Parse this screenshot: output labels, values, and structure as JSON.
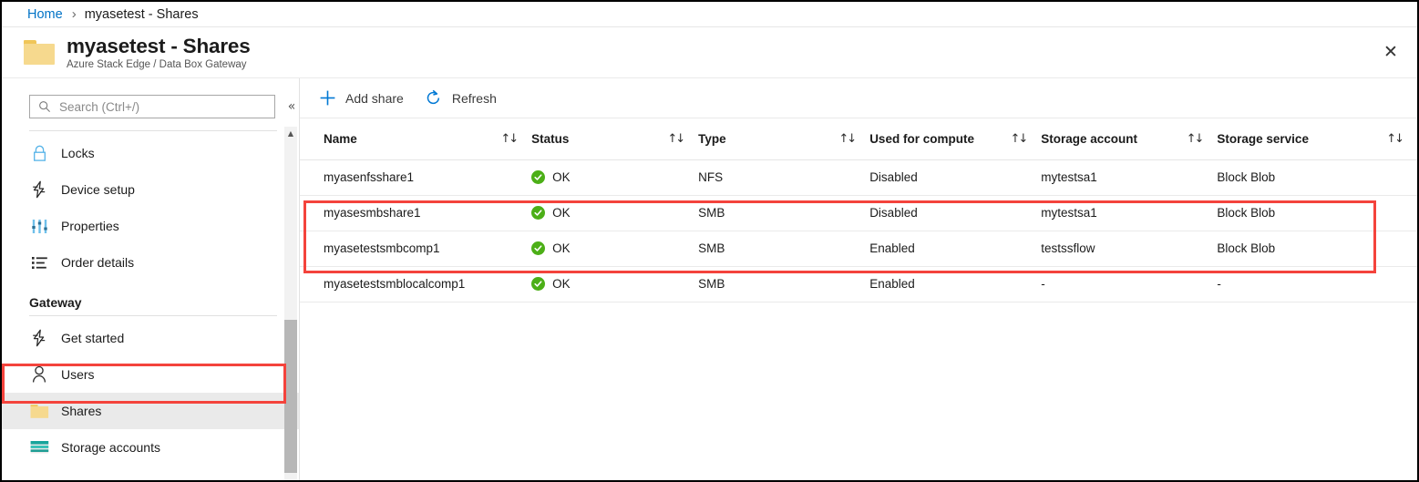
{
  "breadcrumb": {
    "home": "Home",
    "separator": "›",
    "current": "myasetest - Shares"
  },
  "header": {
    "icon": "folder-icon",
    "title": "myasetest - Shares",
    "subtitle": "Azure Stack Edge / Data Box Gateway",
    "close_label": "✕"
  },
  "sidebar": {
    "search": {
      "placeholder": "Search (Ctrl+/)",
      "value": "",
      "icon": "search-icon"
    },
    "collapse_label": "«",
    "scroll_up_label": "▲",
    "items": [
      {
        "label": "Locks",
        "icon": "lock-icon",
        "selected": false
      },
      {
        "label": "Device setup",
        "icon": "lightning-icon",
        "selected": false
      },
      {
        "label": "Properties",
        "icon": "sliders-icon",
        "selected": false
      },
      {
        "label": "Order details",
        "icon": "list-icon",
        "selected": false
      }
    ],
    "group": {
      "title": "Gateway",
      "items": [
        {
          "label": "Get started",
          "icon": "lightning-icon",
          "selected": false
        },
        {
          "label": "Users",
          "icon": "person-icon",
          "selected": false
        },
        {
          "label": "Shares",
          "icon": "folder-icon",
          "selected": true
        },
        {
          "label": "Storage accounts",
          "icon": "storage-icon",
          "selected": false
        }
      ]
    }
  },
  "toolbar": {
    "add_share_label": "Add share",
    "add_share_icon": "plus-icon",
    "refresh_label": "Refresh",
    "refresh_icon": "refresh-icon"
  },
  "table": {
    "sort_icon": "↑↓",
    "columns": [
      "Name",
      "Status",
      "Type",
      "Used for compute",
      "Storage account",
      "Storage service"
    ],
    "rows": [
      {
        "name": "myasenfsshare1",
        "status": "OK",
        "status_icon": "check-circle-icon",
        "type": "NFS",
        "used_for_compute": "Disabled",
        "storage_account": "mytestsa1",
        "storage_service": "Block Blob",
        "highlighted": false
      },
      {
        "name": "myasesmbshare1",
        "status": "OK",
        "status_icon": "check-circle-icon",
        "type": "SMB",
        "used_for_compute": "Disabled",
        "storage_account": "mytestsa1",
        "storage_service": "Block Blob",
        "highlighted": false
      },
      {
        "name": "myasetestsmbcomp1",
        "status": "OK",
        "status_icon": "check-circle-icon",
        "type": "SMB",
        "used_for_compute": "Enabled",
        "storage_account": "testssflow",
        "storage_service": "Block Blob",
        "highlighted": true
      },
      {
        "name": "myasetestsmblocalcomp1",
        "status": "OK",
        "status_icon": "check-circle-icon",
        "type": "SMB",
        "used_for_compute": "Enabled",
        "storage_account": "-",
        "storage_service": "-",
        "highlighted": true
      }
    ]
  },
  "colors": {
    "link": "#0072c6",
    "accent": "#0078d4",
    "highlight_box": "#f4433c",
    "status_ok": "#4caf17",
    "folder": "#f6d98e",
    "selected_row": "#eaeaea"
  }
}
